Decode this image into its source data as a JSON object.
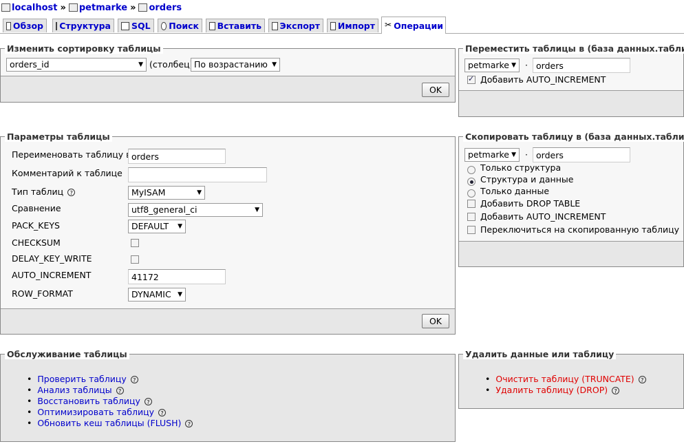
{
  "breadcrumb": {
    "server": "localhost",
    "database": "petmarke",
    "table": "orders",
    "sep": "»"
  },
  "tabs": [
    {
      "label": "Обзор",
      "icon": "browse-icon"
    },
    {
      "label": "Структура",
      "icon": "structure-icon"
    },
    {
      "label": "SQL",
      "icon": "sql-icon"
    },
    {
      "label": "Поиск",
      "icon": "search-icon"
    },
    {
      "label": "Вставить",
      "icon": "insert-icon"
    },
    {
      "label": "Экспорт",
      "icon": "export-icon"
    },
    {
      "label": "Импорт",
      "icon": "import-icon"
    },
    {
      "label": "Операции",
      "icon": "operations-icon",
      "active": true
    }
  ],
  "sort": {
    "legend": "Изменить сортировку таблицы",
    "column": "orders_id",
    "column_hint": "(столбец)",
    "order": "По возрастанию",
    "ok": "OK"
  },
  "move": {
    "legend": "Переместить таблицы в (база данных.таблица):",
    "db": "petmarke",
    "dot": "·",
    "table": "orders",
    "auto_inc_label": "Добавить AUTO_INCREMENT",
    "auto_inc_checked": true
  },
  "params": {
    "legend": "Параметры таблицы",
    "rename_label": "Переименовать таблицу в",
    "rename_value": "orders",
    "comment_label": "Комментарий к таблице",
    "comment_value": "",
    "type_label": "Тип таблиц",
    "type_value": "MyISAM",
    "collation_label": "Сравнение",
    "collation_value": "utf8_general_ci",
    "pack_keys_label": "PACK_KEYS",
    "pack_keys_value": "DEFAULT",
    "checksum_label": "CHECKSUM",
    "delay_key_write_label": "DELAY_KEY_WRITE",
    "auto_increment_label": "AUTO_INCREMENT",
    "auto_increment_value": "41172",
    "row_format_label": "ROW_FORMAT",
    "row_format_value": "DYNAMIC",
    "ok": "OK"
  },
  "copy": {
    "legend": "Скопировать таблицу в (база данных.таблица):",
    "db": "petmarke",
    "dot": "·",
    "table": "orders",
    "opt_structure": "Только структура",
    "opt_structure_data": "Структура и данные",
    "opt_data": "Только данные",
    "drop_table": "Добавить DROP TABLE",
    "auto_inc": "Добавить AUTO_INCREMENT",
    "switch": "Переключиться на скопированную таблицу"
  },
  "maintenance": {
    "legend": "Обслуживание таблицы",
    "links": [
      "Проверить таблицу",
      "Анализ таблицы",
      "Восстановить таблицу",
      "Оптимизировать таблицу",
      "Обновить кеш таблицы (FLUSH)"
    ]
  },
  "delete": {
    "legend": "Удалить данные или таблицу",
    "links": [
      "Очистить таблицу (TRUNCATE)",
      "Удалить таблицу (DROP)"
    ]
  },
  "help_glyph": "?",
  "colors": {
    "link": "#0000cc",
    "danger": "#e00000",
    "panel": "#e7e7e7"
  }
}
